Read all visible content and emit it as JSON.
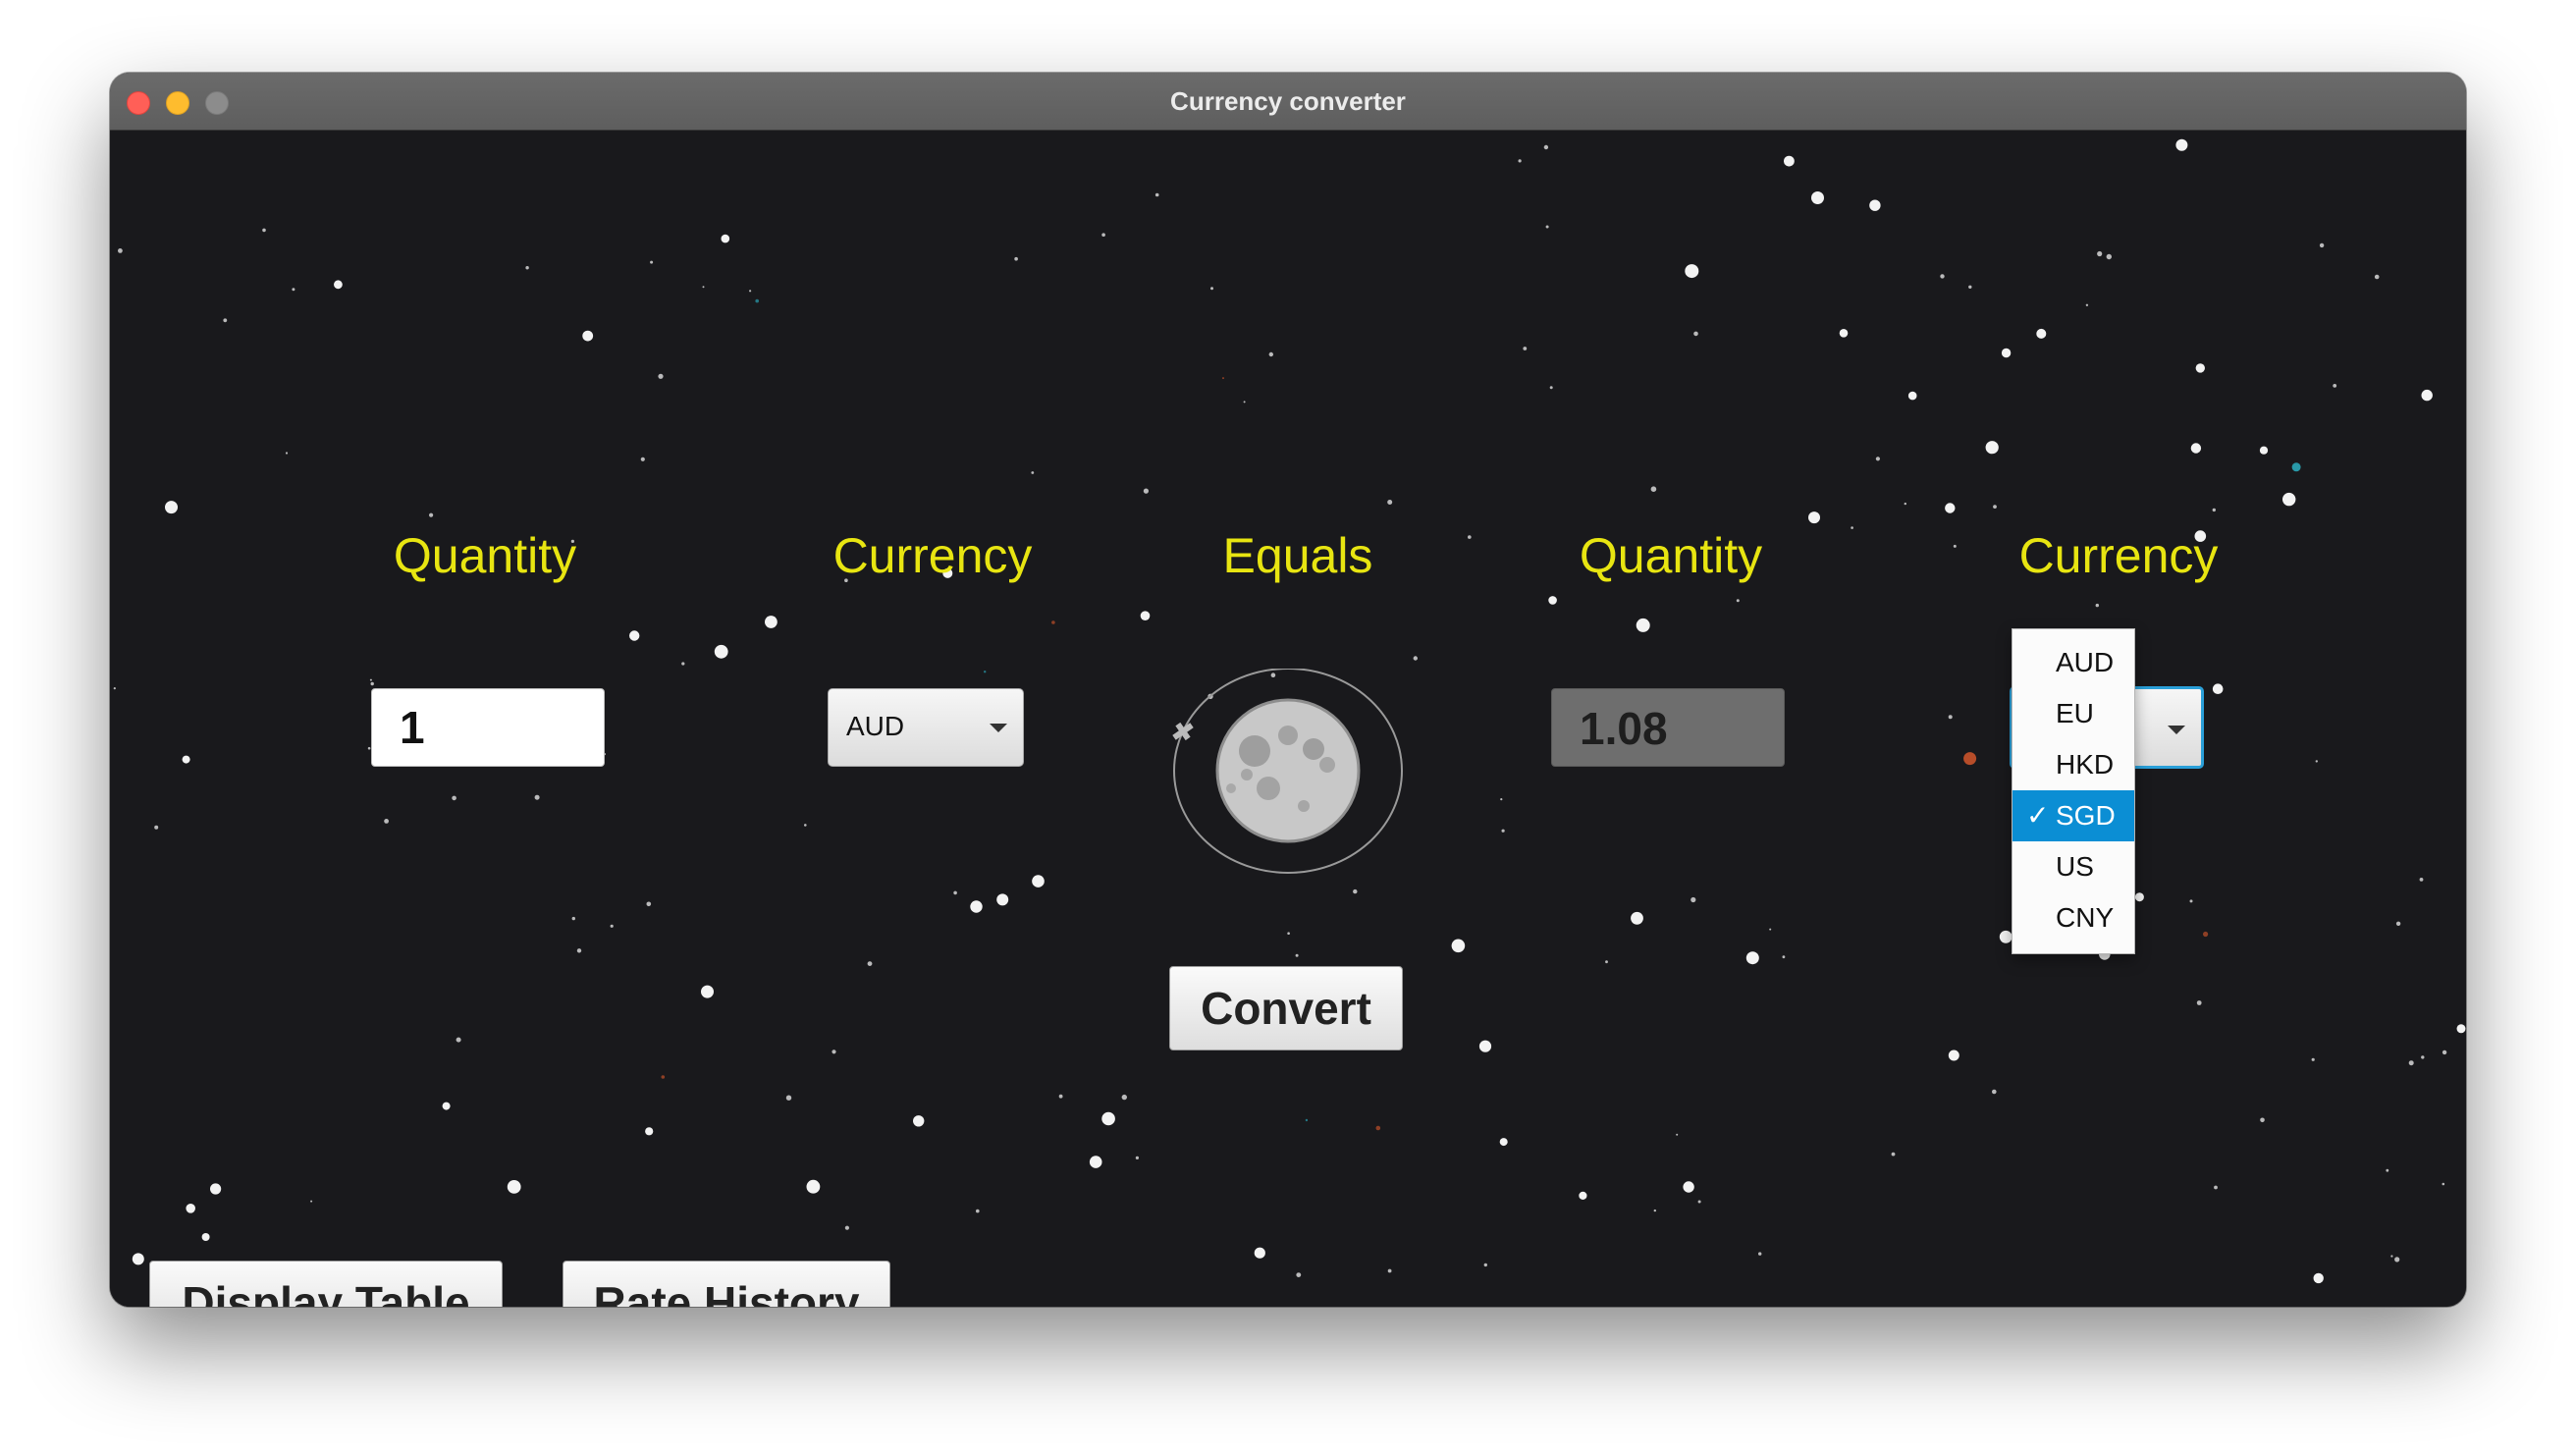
{
  "window": {
    "title": "Currency converter"
  },
  "labels": {
    "from_quantity": "Quantity",
    "from_currency": "Currency",
    "equals": "Equals",
    "to_quantity": "Quantity",
    "to_currency": "Currency"
  },
  "from": {
    "quantity_value": "1",
    "currency_selected": "AUD"
  },
  "to": {
    "quantity_value": "1.08",
    "currency_selected": "SGD",
    "dropdown_open": true,
    "options": [
      "AUD",
      "EU",
      "HKD",
      "SGD",
      "US",
      "CNY"
    ],
    "check_mark": "✓"
  },
  "buttons": {
    "convert": "Convert",
    "display_table": "Display Table",
    "rate_history": "Rate History"
  },
  "colors": {
    "background": "#19191c",
    "label": "#e8e511",
    "selection": "#0b8ed4",
    "focus_ring": "#2a9fd8"
  }
}
